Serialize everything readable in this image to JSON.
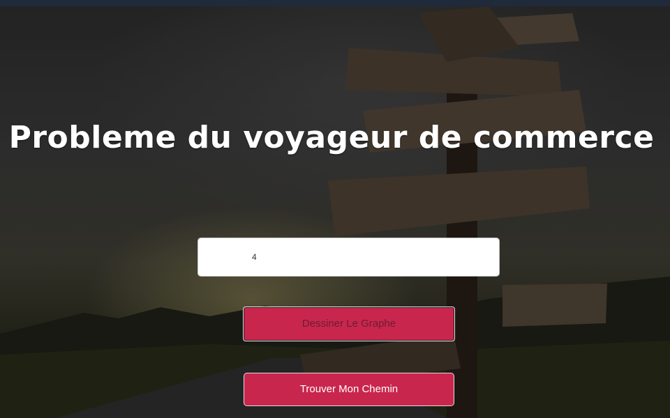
{
  "title": "Probleme du voyageur de commerce",
  "input": {
    "value": "4"
  },
  "buttons": {
    "draw_graph": "Dessiner Le Graphe",
    "find_path": "Trouver Mon Chemin"
  },
  "colors": {
    "button_bg": "#c9264d",
    "title_text": "#ffffff",
    "input_bg": "#ffffff"
  },
  "background": {
    "description_icon": "signpost-background-image"
  }
}
